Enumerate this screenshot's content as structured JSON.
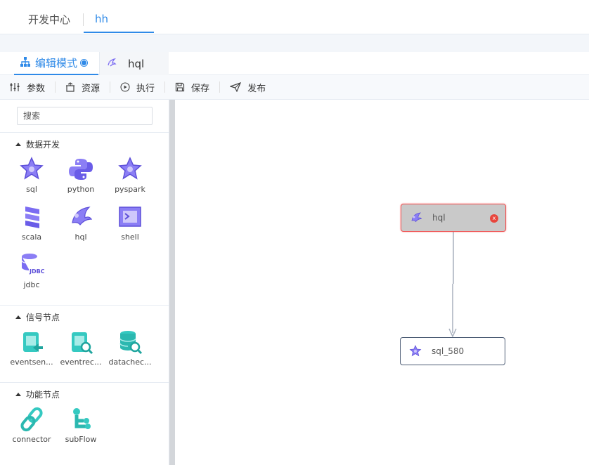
{
  "top_tabs": [
    "开发中心",
    "hh"
  ],
  "editor_tabs": {
    "edit_mode": "编辑模式",
    "hql": "hql"
  },
  "toolbar": {
    "params": "参数",
    "resources": "资源",
    "execute": "执行",
    "save": "保存",
    "publish": "发布"
  },
  "sidebar": {
    "search_placeholder": "搜索",
    "sections": [
      {
        "title": "数据开发",
        "items": [
          "sql",
          "python",
          "pyspark",
          "scala",
          "hql",
          "shell",
          "jdbc"
        ]
      },
      {
        "title": "信号节点",
        "items": [
          "eventsen...",
          "eventrec...",
          "datachec..."
        ]
      },
      {
        "title": "功能节点",
        "items": [
          "connector",
          "subFlow"
        ]
      }
    ]
  },
  "canvas": {
    "nodes": [
      {
        "label": "hql",
        "selected": true,
        "icon": "hql-icon"
      },
      {
        "label": "sql_580",
        "selected": false,
        "icon": "sql-icon"
      }
    ],
    "close_glyph": "x"
  },
  "colors": {
    "accent": "#2f8ae8",
    "node_icon": "#7b6cf2",
    "signal_icon": "#35c9c1",
    "danger": "#e8453c"
  }
}
